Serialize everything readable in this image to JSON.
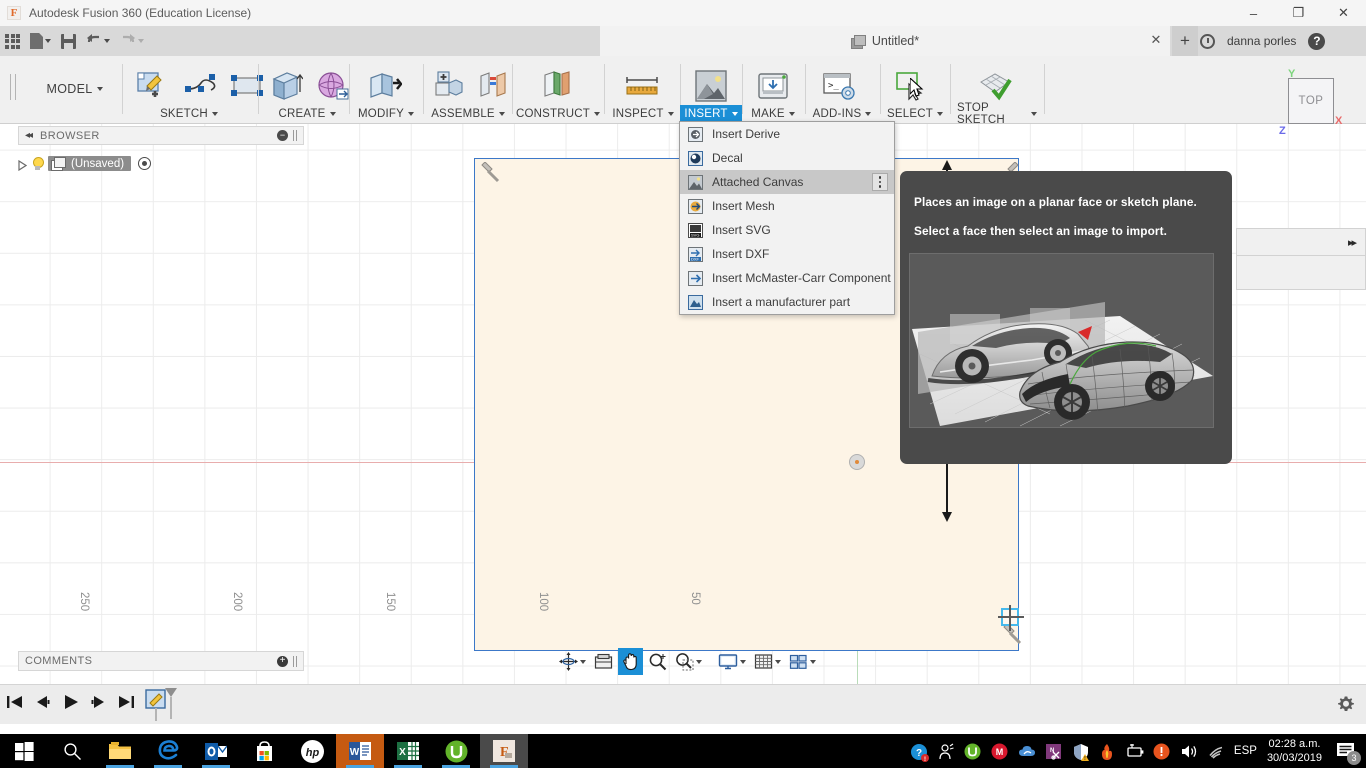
{
  "titlebar": {
    "app_title": "Autodesk Fusion 360 (Education License)",
    "logo_glyph": "F",
    "minimize": "–",
    "maximize": "❐",
    "close": "✕"
  },
  "tabstrip": {
    "document_tab": "Untitled*",
    "close_tab": "✕",
    "new_tab": "+",
    "username": "danna porles",
    "help": "?"
  },
  "quickbar": {
    "items": [
      {
        "name": "app-grid-icon",
        "label": ""
      },
      {
        "name": "new-document-icon",
        "label": ""
      },
      {
        "name": "save-icon",
        "label": ""
      },
      {
        "name": "undo-icon",
        "label": ""
      },
      {
        "name": "redo-icon",
        "label": ""
      }
    ]
  },
  "ribbon": {
    "workspace": "MODEL",
    "groups": [
      {
        "name": "sketch",
        "label": "SKETCH",
        "active": false
      },
      {
        "name": "create",
        "label": "CREATE",
        "active": false
      },
      {
        "name": "modify",
        "label": "MODIFY",
        "active": false
      },
      {
        "name": "assemble",
        "label": "ASSEMBLE",
        "active": false
      },
      {
        "name": "construct",
        "label": "CONSTRUCT",
        "active": false
      },
      {
        "name": "inspect",
        "label": "INSPECT",
        "active": false
      },
      {
        "name": "insert",
        "label": "INSERT",
        "active": true
      },
      {
        "name": "make",
        "label": "MAKE",
        "active": false
      },
      {
        "name": "add-ins",
        "label": "ADD-INS",
        "active": false
      },
      {
        "name": "select",
        "label": "SELECT",
        "active": false
      },
      {
        "name": "stop-sketch",
        "label": "STOP SKETCH",
        "active": false
      }
    ]
  },
  "insert_menu": {
    "items": [
      {
        "label": "Insert Derive",
        "icon": "insert-derive-icon",
        "highlighted": false
      },
      {
        "label": "Decal",
        "icon": "decal-icon",
        "highlighted": false
      },
      {
        "label": "Attached Canvas",
        "icon": "attached-canvas-icon",
        "highlighted": true
      },
      {
        "label": "Insert Mesh",
        "icon": "insert-mesh-icon",
        "highlighted": false
      },
      {
        "label": "Insert SVG",
        "icon": "insert-svg-icon",
        "highlighted": false
      },
      {
        "label": "Insert DXF",
        "icon": "insert-dxf-icon",
        "highlighted": false
      },
      {
        "label": "Insert McMaster-Carr Component",
        "icon": "mcmaster-carr-icon",
        "highlighted": false
      },
      {
        "label": "Insert a manufacturer part",
        "icon": "manufacturer-part-icon",
        "highlighted": false
      }
    ]
  },
  "tooltip": {
    "line1": "Places an image on a planar face or sketch plane.",
    "line2": "Select a face then select an image to import."
  },
  "browser": {
    "title": "BROWSER",
    "collapse_glyph": "◂◂",
    "minus_glyph": "−",
    "root_item": "(Unsaved)"
  },
  "comments": {
    "title": "COMMENTS",
    "plus_glyph": "+"
  },
  "viewcube": {
    "face": "TOP",
    "axis_x": "X",
    "axis_y": "Y",
    "axis_z": "Z",
    "color_x": "#e86a6a",
    "color_y": "#7cd47c",
    "color_z": "#6a6ae8"
  },
  "rulers": {
    "labels": [
      "250",
      "200",
      "150",
      "100",
      "50"
    ],
    "positions": [
      84,
      237,
      390,
      543,
      696
    ]
  },
  "navbar": {
    "items": [
      {
        "name": "orbit-button",
        "caret": true,
        "active": false
      },
      {
        "name": "look-at-button",
        "caret": false,
        "active": false
      },
      {
        "name": "pan-button",
        "caret": false,
        "active": true
      },
      {
        "name": "zoom-button",
        "caret": false,
        "active": false
      },
      {
        "name": "fit-button",
        "caret": true,
        "active": false
      },
      {
        "name": "display-settings-button",
        "caret": true,
        "active": false
      },
      {
        "name": "grid-snaps-button",
        "caret": true,
        "active": false
      },
      {
        "name": "viewports-button",
        "caret": true,
        "active": false
      }
    ]
  },
  "timeline": {
    "controls": [
      "go-to-beginning",
      "step-back",
      "play",
      "step-forward",
      "go-to-end"
    ],
    "marker": "sketch-marker"
  },
  "taskbar": {
    "apps": [
      {
        "name": "start-button",
        "label": "Windows"
      },
      {
        "name": "search-button",
        "label": "Search"
      },
      {
        "name": "file-explorer",
        "label": "File Explorer"
      },
      {
        "name": "edge-browser",
        "label": "Microsoft Edge"
      },
      {
        "name": "outlook",
        "label": "Outlook"
      },
      {
        "name": "microsoft-store",
        "label": "Store"
      },
      {
        "name": "hp-app",
        "label": "HP"
      },
      {
        "name": "word",
        "label": "Word"
      },
      {
        "name": "excel",
        "label": "Excel"
      },
      {
        "name": "utorrent",
        "label": "uTorrent"
      },
      {
        "name": "fusion360",
        "label": "Fusion 360"
      }
    ],
    "tray": {
      "language": "ESP",
      "time": "02:28 a.m.",
      "date": "30/03/2019",
      "notification_count": "3"
    }
  }
}
